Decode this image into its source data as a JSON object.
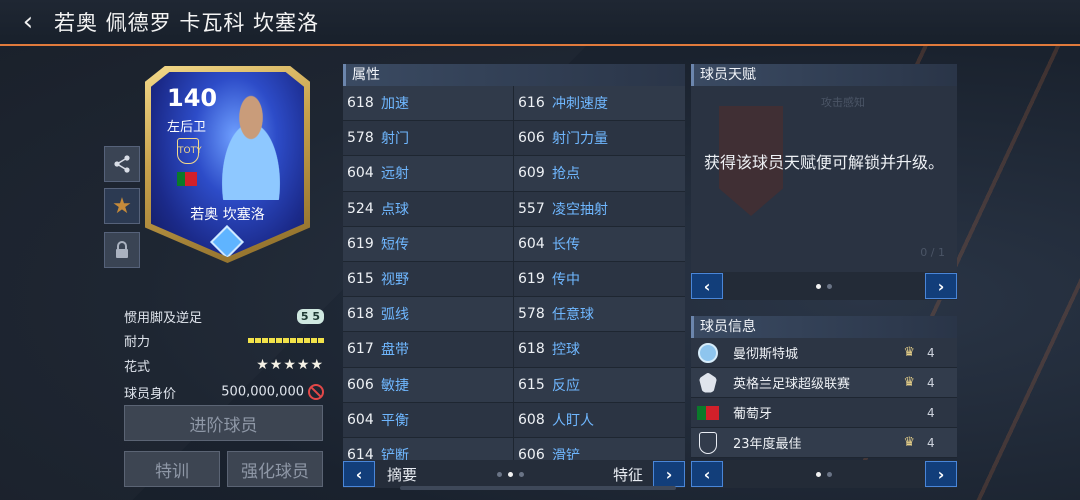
{
  "header": {
    "title": "若奥 佩德罗 卡瓦科 坎塞洛"
  },
  "card": {
    "rating": "140",
    "position": "左后卫",
    "name": "若奥 坎塞洛",
    "badge": "TOTY"
  },
  "side_buttons": [
    "share-icon",
    "star-icon",
    "lock-icon"
  ],
  "info": {
    "foot_label": "惯用脚及逆足",
    "foot_value": "5 5",
    "stamina_label": "耐力",
    "stamina_level": 1.0,
    "skill_label": "花式",
    "skill_stars": 5,
    "star_glyphs": "★★★★★",
    "price_label": "球员身价",
    "price_value": "500,000,000"
  },
  "buttons": {
    "advance": "进阶球员",
    "training": "特训",
    "upgrade": "强化球员"
  },
  "attributes": {
    "header": "属性",
    "rows": [
      [
        {
          "v": "618",
          "n": "加速"
        },
        {
          "v": "616",
          "n": "冲刺速度"
        }
      ],
      [
        {
          "v": "578",
          "n": "射门"
        },
        {
          "v": "606",
          "n": "射门力量"
        }
      ],
      [
        {
          "v": "604",
          "n": "远射"
        },
        {
          "v": "609",
          "n": "抢点"
        }
      ],
      [
        {
          "v": "524",
          "n": "点球"
        },
        {
          "v": "557",
          "n": "凌空抽射"
        }
      ],
      [
        {
          "v": "619",
          "n": "短传"
        },
        {
          "v": "604",
          "n": "长传"
        }
      ],
      [
        {
          "v": "615",
          "n": "视野"
        },
        {
          "v": "619",
          "n": "传中"
        }
      ],
      [
        {
          "v": "618",
          "n": "弧线"
        },
        {
          "v": "578",
          "n": "任意球"
        }
      ],
      [
        {
          "v": "617",
          "n": "盘带"
        },
        {
          "v": "618",
          "n": "控球"
        }
      ],
      [
        {
          "v": "606",
          "n": "敏捷"
        },
        {
          "v": "615",
          "n": "反应"
        }
      ],
      [
        {
          "v": "604",
          "n": "平衡"
        },
        {
          "v": "608",
          "n": "人盯人"
        }
      ],
      [
        {
          "v": "614",
          "n": "铲断"
        },
        {
          "v": "606",
          "n": "滑铲"
        }
      ]
    ],
    "footer_left": "摘要",
    "footer_right": "特征",
    "prev": "‹",
    "next": "›"
  },
  "talent": {
    "header": "球员天赋",
    "ghost_label": "攻击感知",
    "message": "获得该球员天赋便可解锁并升级。",
    "count": "0 / 1",
    "prev": "‹",
    "next": "›"
  },
  "player_info": {
    "header": "球员信息",
    "rows": [
      {
        "icon": "club-icon",
        "name": "曼彻斯特城",
        "trophy": true,
        "count": "4"
      },
      {
        "icon": "league-icon",
        "name": "英格兰足球超级联赛",
        "trophy": true,
        "count": "4"
      },
      {
        "icon": "flag-icon",
        "name": "葡萄牙",
        "trophy": false,
        "count": "4"
      },
      {
        "icon": "toty-icon",
        "name": "23年度最佳",
        "trophy": true,
        "count": "4"
      }
    ],
    "prev": "‹",
    "next": "›"
  },
  "colors": {
    "accent": "#e07a3c",
    "attr_name": "#6fb7ff",
    "nav_button": "#123e7a"
  }
}
